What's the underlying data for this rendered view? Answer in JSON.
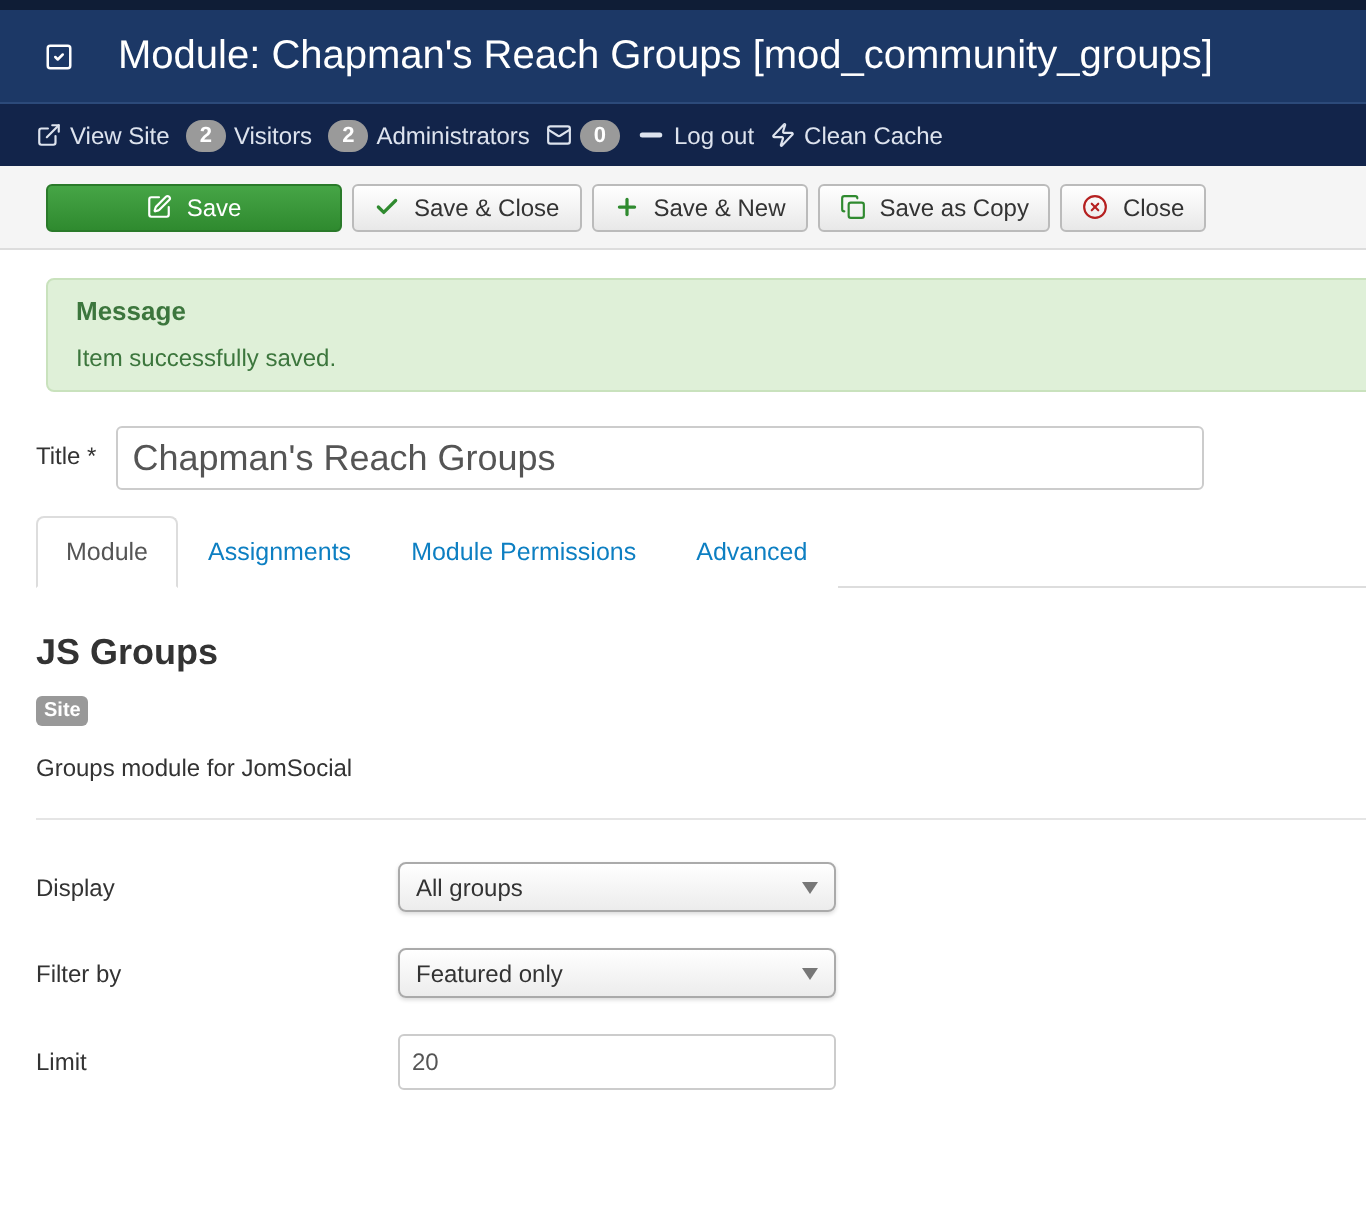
{
  "header": {
    "title": "Module: Chapman's Reach Groups [mod_community_groups]"
  },
  "status_bar": [
    {
      "kind": "link",
      "label": "View Site"
    },
    {
      "kind": "count",
      "count": "2",
      "label": "Visitors"
    },
    {
      "kind": "count",
      "count": "2",
      "label": "Administrators"
    },
    {
      "kind": "mail",
      "count": "0"
    },
    {
      "kind": "logout",
      "label": "Log out"
    },
    {
      "kind": "cache",
      "label": "Clean Cache"
    }
  ],
  "toolbar": [
    {
      "kind": "save",
      "label": "Save"
    },
    {
      "kind": "check",
      "label": "Save & Close"
    },
    {
      "kind": "plus",
      "label": "Save & New"
    },
    {
      "kind": "copy",
      "label": "Save as Copy"
    },
    {
      "kind": "close",
      "label": "Close"
    }
  ],
  "message": {
    "heading": "Message",
    "text": "Item successfully saved."
  },
  "title_field": {
    "label": "Title *",
    "value": "Chapman's Reach Groups"
  },
  "tabs": [
    {
      "label": "Module",
      "selected": true
    },
    {
      "label": "Assignments",
      "selected": false
    },
    {
      "label": "Module Permissions",
      "selected": false
    },
    {
      "label": "Advanced",
      "selected": false
    }
  ],
  "module": {
    "name": "JS Groups",
    "badge": "Site",
    "description": "Groups module for JomSocial"
  },
  "fields": [
    {
      "kind": "select",
      "label": "Display",
      "value": "All groups"
    },
    {
      "kind": "select",
      "label": "Filter by",
      "value": "Featured only"
    },
    {
      "kind": "text",
      "label": "Limit",
      "value": "20"
    }
  ]
}
